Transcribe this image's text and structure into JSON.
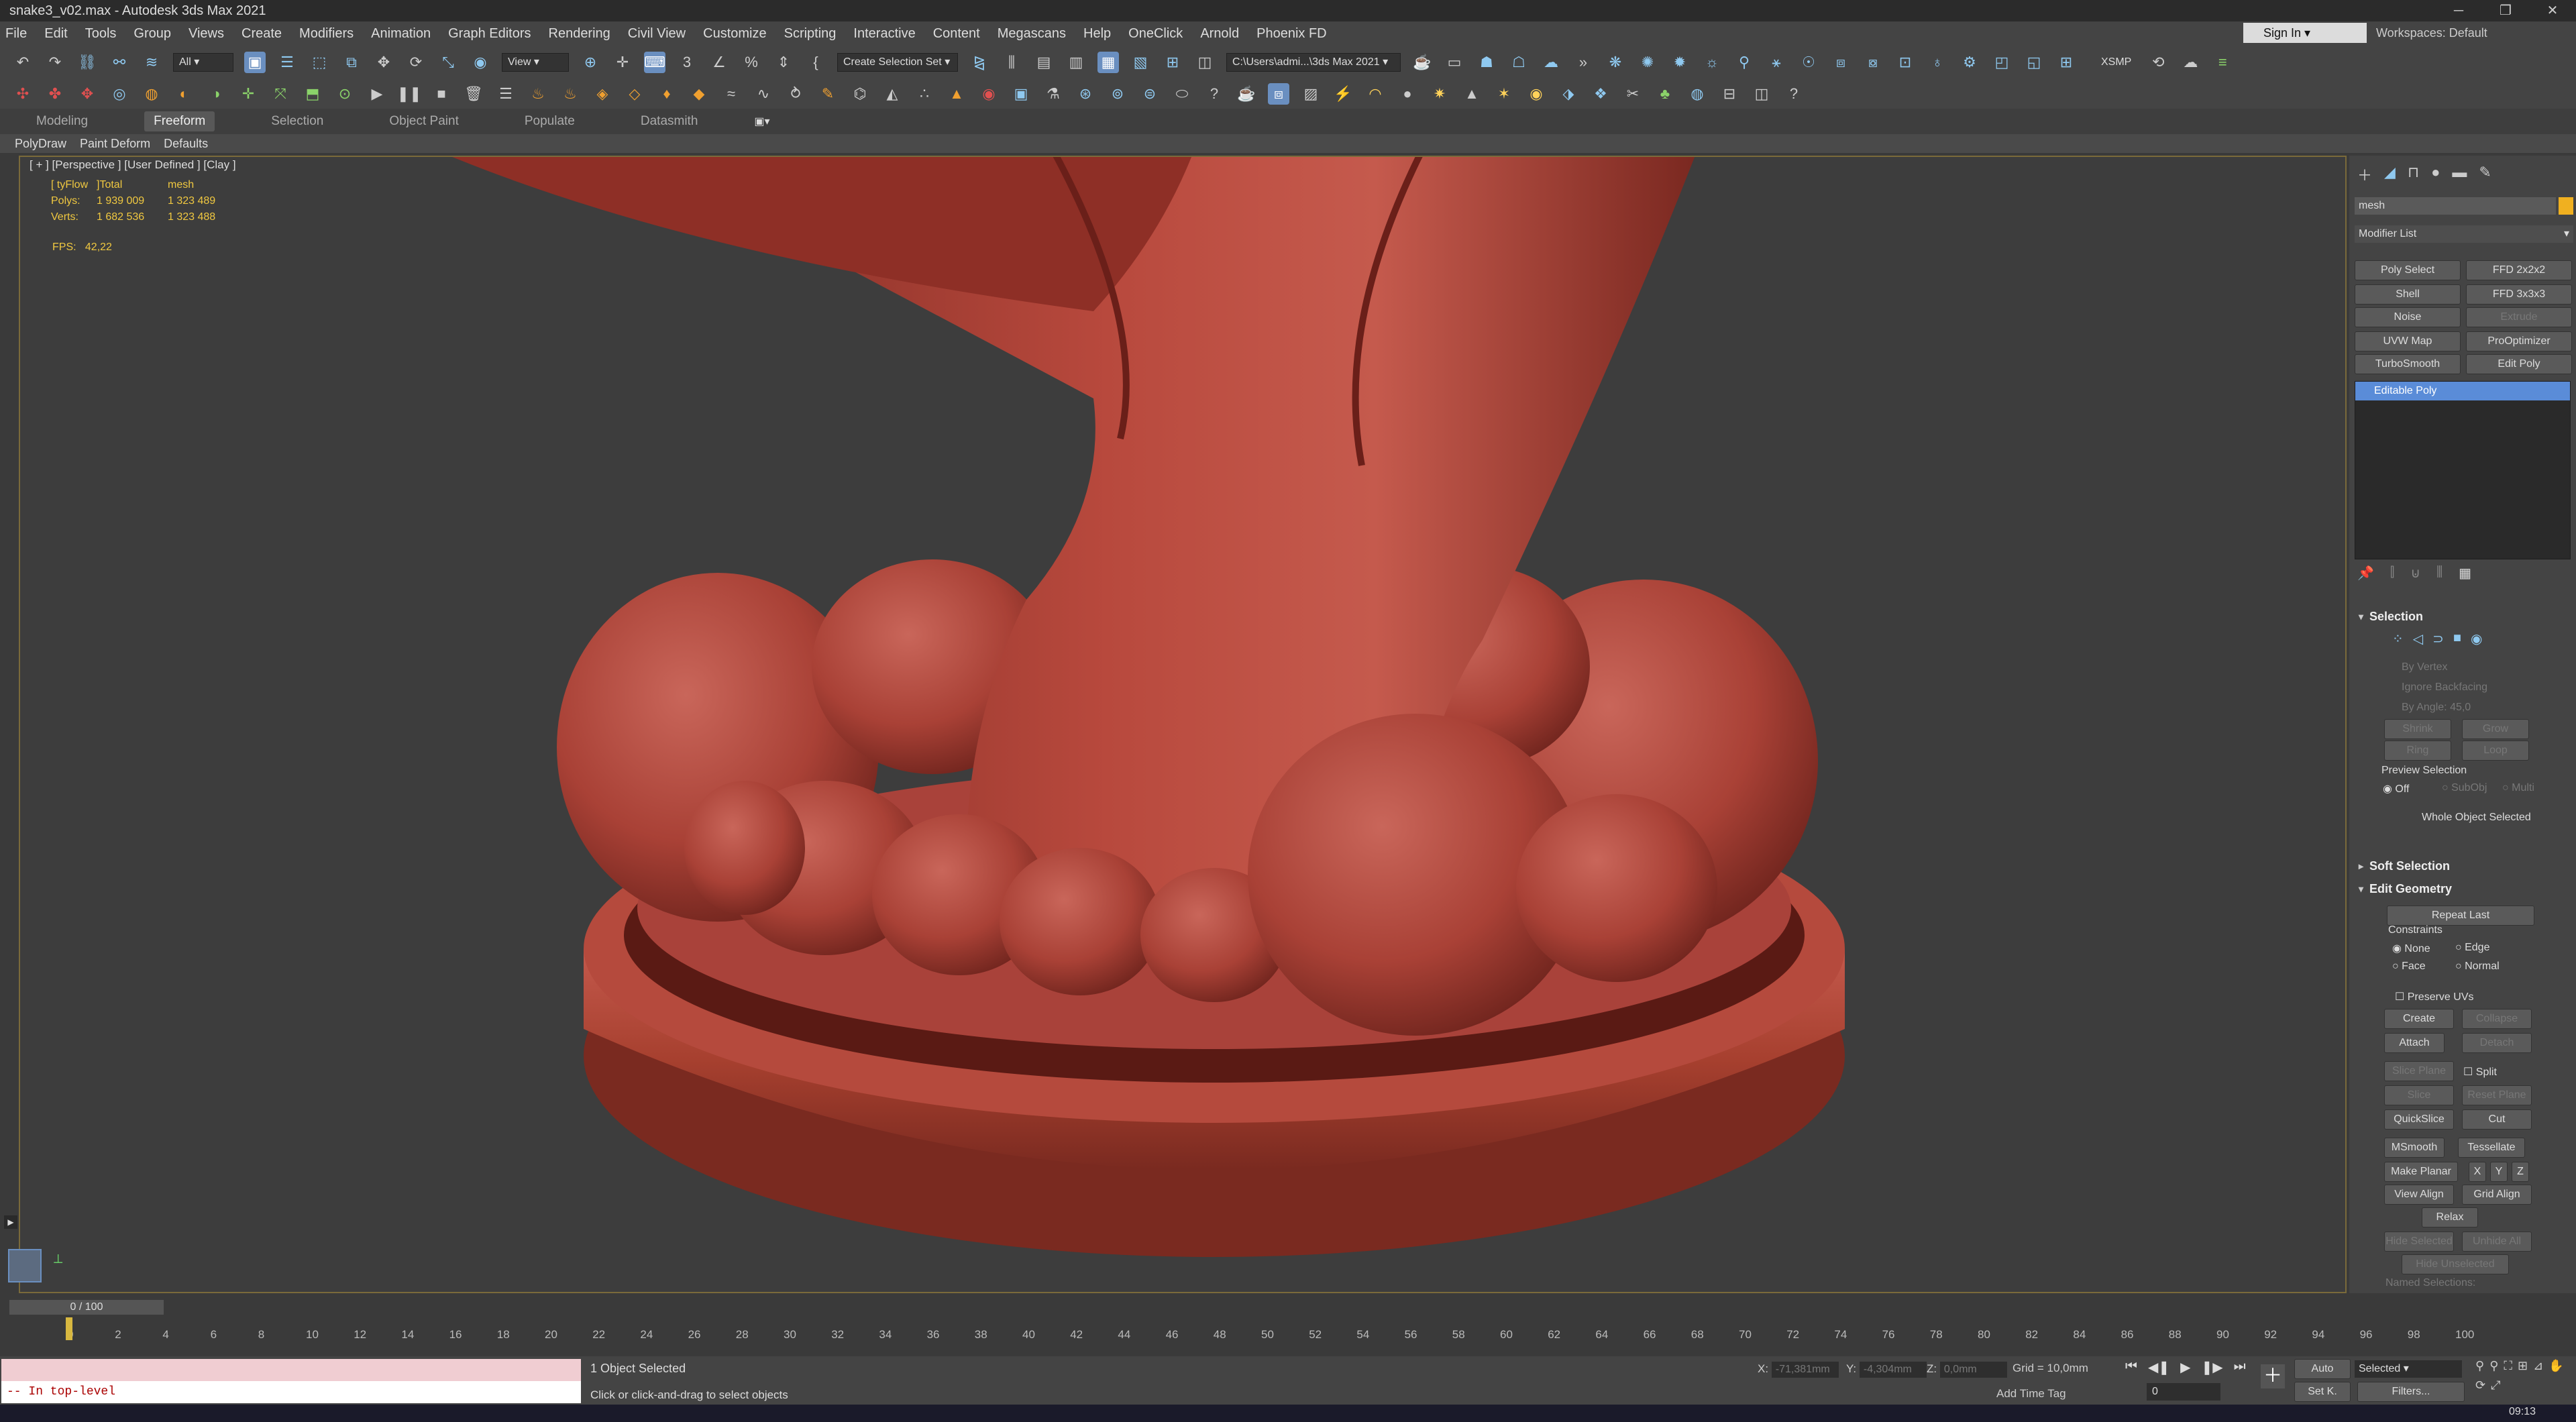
{
  "window": {
    "title": "snake3_v02.max - Autodesk 3ds Max 2021"
  },
  "menu": [
    "File",
    "Edit",
    "Tools",
    "Group",
    "Views",
    "Create",
    "Modifiers",
    "Animation",
    "Graph Editors",
    "Rendering",
    "Civil View",
    "Customize",
    "Scripting",
    "Interactive",
    "Content",
    "Megascans",
    "Help",
    "OneClick",
    "Arnold",
    "Phoenix FD"
  ],
  "account": {
    "signin": "Sign In",
    "workspaces_label": "Workspaces:",
    "workspaces_value": "Default"
  },
  "toolbar": {
    "filter": "All",
    "view": "View",
    "selection_set": "Create Selection Set",
    "path": "C:\\Users\\admi...\\3ds Max 2021",
    "xsmp": "XSMP"
  },
  "ribbon": {
    "tabs": [
      "Modeling",
      "Freeform",
      "Selection",
      "Object Paint",
      "Populate",
      "Datasmith"
    ],
    "active": "Freeform",
    "tools": [
      "PolyDraw",
      "Paint Deform",
      "Defaults"
    ]
  },
  "viewport": {
    "label": "[ + ] [Perspective ] [User Defined ] [Clay ]",
    "stats_header": [
      "[ tyFlow",
      "]Total",
      "mesh"
    ],
    "stats_rows": [
      [
        "Polys:",
        "1 939 009",
        "1 323 489"
      ],
      [
        "Verts:",
        "1 682 536",
        "1 323 488"
      ]
    ],
    "fps_label": "FPS:",
    "fps_value": "42,22"
  },
  "command_panel": {
    "object_name": "mesh",
    "modifier_list": "Modifier List",
    "modifier_buttons": [
      "Poly Select",
      "FFD 2x2x2",
      "Shell",
      "FFD 3x3x3",
      "Noise",
      "Extrude",
      "UVW Map",
      "ProOptimizer",
      "TurboSmooth",
      "Edit Poly"
    ],
    "stack_item": "Editable Poly",
    "selection": {
      "title": "Selection",
      "by_vertex": "By Vertex",
      "ignore_backfacing": "Ignore Backfacing",
      "by_angle": "By Angle:",
      "by_angle_value": "45,0",
      "shrink": "Shrink",
      "grow": "Grow",
      "ring": "Ring",
      "loop": "Loop",
      "preview": "Preview Selection",
      "off": "Off",
      "subobj": "SubObj",
      "multi": "Multi",
      "status": "Whole Object Selected"
    },
    "soft_selection": "Soft Selection",
    "edit_geometry": {
      "title": "Edit Geometry",
      "repeat_last": "Repeat Last",
      "constraints": "Constraints",
      "none": "None",
      "edge": "Edge",
      "face": "Face",
      "normal": "Normal",
      "preserve_uvs": "Preserve UVs",
      "create": "Create",
      "collapse": "Collapse",
      "attach": "Attach",
      "detach": "Detach",
      "slice_plane": "Slice Plane",
      "split": "Split",
      "slice": "Slice",
      "reset_plane": "Reset Plane",
      "quickslice": "QuickSlice",
      "cut": "Cut",
      "msmooth": "MSmooth",
      "tessellate": "Tessellate",
      "make_planar": "Make Planar",
      "x": "X",
      "y": "Y",
      "z": "Z",
      "view_align": "View Align",
      "grid_align": "Grid Align",
      "relax": "Relax",
      "hide_selected": "Hide Selected",
      "unhide_all": "Unhide All",
      "hide_unselected": "Hide Unselected",
      "named_selections": "Named Selections:"
    }
  },
  "timeline": {
    "slider": "0 / 100",
    "ticks": [
      0,
      2,
      4,
      6,
      8,
      10,
      12,
      14,
      16,
      18,
      20,
      22,
      24,
      26,
      28,
      30,
      32,
      34,
      36,
      38,
      40,
      42,
      44,
      46,
      48,
      50,
      52,
      54,
      56,
      58,
      60,
      62,
      64,
      66,
      68,
      70,
      72,
      74,
      76,
      78,
      80,
      82,
      84,
      86,
      88,
      90,
      92,
      94,
      96,
      98,
      100
    ]
  },
  "status": {
    "maxscript_input": "-- In top-level",
    "selected": "1 Object Selected",
    "hint": "Click or click-and-drag to select objects",
    "x_label": "X:",
    "x_value": "-71,381mm",
    "y_label": "Y:",
    "y_value": "-4,304mm",
    "z_label": "Z:",
    "z_value": "0,0mm",
    "grid": "Grid = 10,0mm",
    "add_time_tag": "Add Time Tag",
    "auto": "Auto",
    "set_key": "Set K.",
    "selected_dd": "Selected",
    "filters": "Filters...",
    "frame": "0",
    "clock": "09:13"
  },
  "colors": {
    "accent": "#5a8cd8",
    "model": "#b3453a",
    "viewport_bg": "#3d3d3d"
  }
}
